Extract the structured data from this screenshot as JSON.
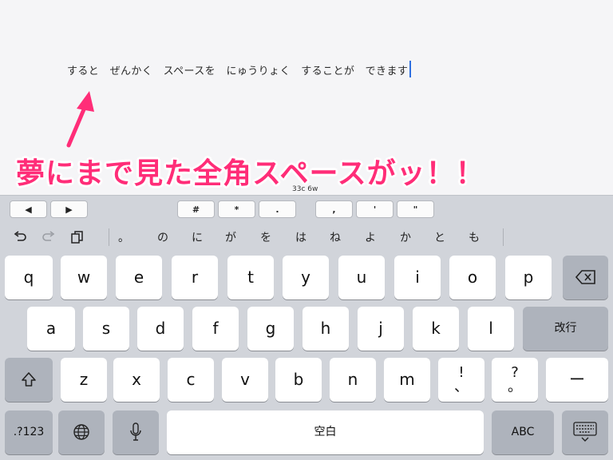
{
  "document": {
    "text": "すると　ぜんかく　スペースを　にゅうりょく　することが　できます",
    "annotation": "夢にまで見た全角スペースがッ！！",
    "counter": "33c  6w"
  },
  "accessory_bar": {
    "buttons": [
      "◀",
      "▶",
      "#",
      "*",
      ".",
      ",",
      "'",
      "\""
    ]
  },
  "keyboard": {
    "shortcut_icons": [
      "undo-icon",
      "redo-icon",
      "paste-icon"
    ],
    "candidates": [
      "。",
      "の",
      "に",
      "が",
      "を",
      "は",
      "ね",
      "よ",
      "か",
      "と",
      "も"
    ],
    "row1": [
      "q",
      "w",
      "e",
      "r",
      "t",
      "y",
      "u",
      "i",
      "o",
      "p"
    ],
    "row2": [
      "a",
      "s",
      "d",
      "f",
      "g",
      "h",
      "j",
      "k",
      "l"
    ],
    "row3": [
      "z",
      "x",
      "c",
      "v",
      "b",
      "n",
      "m"
    ],
    "row3_punct": [
      [
        "!",
        "、"
      ],
      [
        "?",
        "。"
      ]
    ],
    "dash": "ー",
    "return_label": "改行",
    "space_label": "空白",
    "numbers_label": ".?123",
    "abc_label": "ABC"
  },
  "colors": {
    "annotation": "#ff2d78",
    "cursor": "#2f6fe0",
    "keyboard_bg": "#d1d4da",
    "key": "#ffffff",
    "function_key": "#aeb3bc"
  }
}
